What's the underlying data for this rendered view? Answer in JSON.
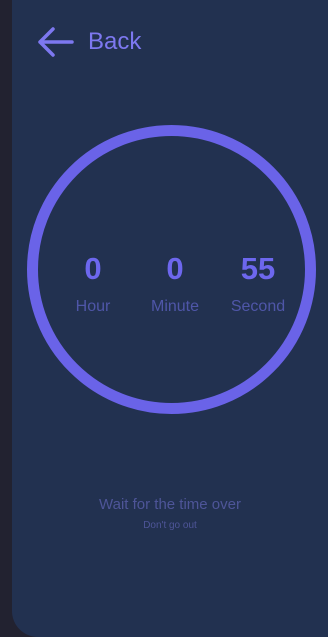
{
  "header": {
    "back_icon": "arrow-left-icon",
    "back_label": "Back"
  },
  "timer": {
    "hour": {
      "value": "0",
      "label": "Hour"
    },
    "minute": {
      "value": "0",
      "label": "Minute"
    },
    "second": {
      "value": "55",
      "label": "Second"
    }
  },
  "message": {
    "main": "Wait for the time over",
    "sub": "Don't go out"
  },
  "colors": {
    "background": "#223150",
    "accent": "#6A63E8",
    "muted_text": "#4E5598"
  }
}
